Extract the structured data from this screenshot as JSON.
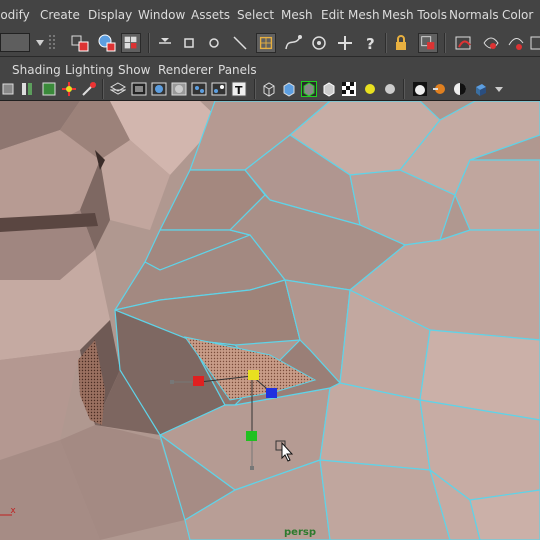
{
  "main_menu": [
    "lodify",
    "Create",
    "Display",
    "Window",
    "Assets",
    "Select",
    "Mesh",
    "Edit Mesh",
    "Mesh Tools",
    "Normals",
    "Color"
  ],
  "panel_menu": [
    "Shading",
    "Lighting",
    "Show",
    "Renderer",
    "Panels"
  ],
  "status_icons": [
    "separator-icon",
    "select-by-hierarchy-icon",
    "select-by-object-icon",
    "select-by-component-icon",
    "rotate-axis-icon",
    "square-icon",
    "circle-icon",
    "line-icon",
    "snap-grid-icon",
    "snap-curve-icon",
    "snap-point-icon",
    "snap-plane-icon",
    "question-icon",
    "lock-icon",
    "input-ops-icon",
    "construction-history-icon",
    "render-frame-icon",
    "ipr-render-icon"
  ],
  "panel_tools": [
    "camera-attributes-icon",
    "bookmarks-icon",
    "image-plane-icon",
    "grid-toggle-icon",
    "film-gate-icon",
    "resolution-gate-icon",
    "gate-mask-icon",
    "field-chart-icon",
    "safe-action-icon",
    "wireframe-icon",
    "smooth-shade-icon",
    "wireframe-on-shaded-icon",
    "textured-icon",
    "use-lights-icon",
    "shadows-icon",
    "screen-space-ao-icon",
    "motion-blur-icon",
    "isolate-select-icon",
    "xray-icon"
  ],
  "viewport": {
    "camera": "persp",
    "axis": "_x"
  },
  "colors": {
    "wire": "#5fd3e8",
    "mesh_base": "#b39a92",
    "manipulator_x": "#e02020",
    "manipulator_y": "#e8e020",
    "manipulator_z": "#2030e0",
    "manipulator_center": "#20c020"
  }
}
